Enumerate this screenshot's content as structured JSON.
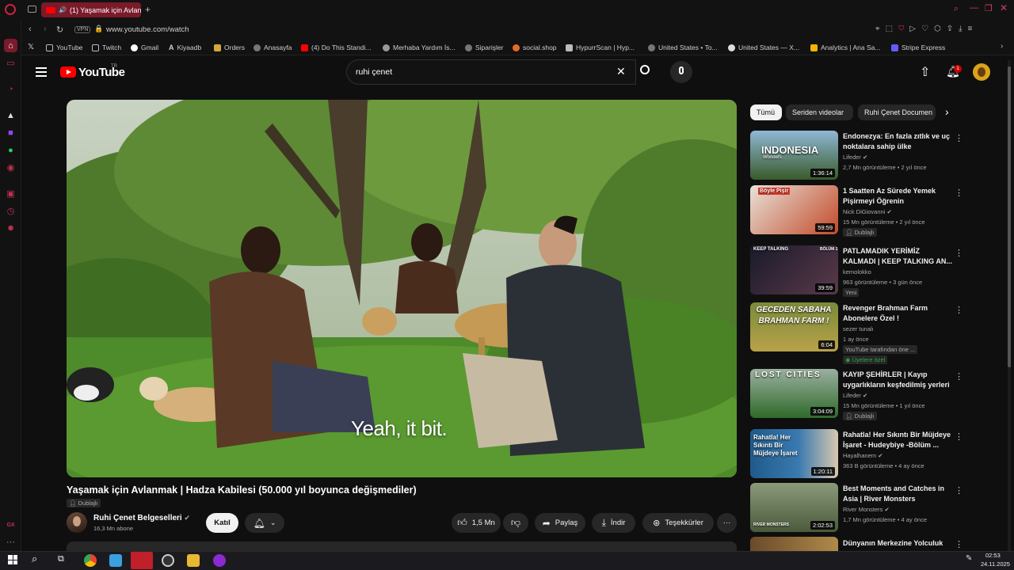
{
  "browser": {
    "tab_title": "(1) Yaşamak için Avlan",
    "url": "www.youtube.com/watch",
    "vpn_label": "VPN",
    "bookmarks": [
      {
        "label": "YouTube",
        "icon": "document-icon"
      },
      {
        "label": "Twitch",
        "icon": "document-icon"
      },
      {
        "label": "Gmail",
        "icon": "google-icon"
      },
      {
        "label": "Kiyaadb",
        "icon": "a-icon"
      },
      {
        "label": "Orders",
        "icon": "folder-icon"
      },
      {
        "label": "Anasayfa",
        "icon": "person-icon"
      },
      {
        "label": "(4) Do This Standi...",
        "icon": "youtube-icon"
      },
      {
        "label": "Merhaba Yardım İs...",
        "icon": "gear-icon"
      },
      {
        "label": "Siparişler",
        "icon": "person-icon"
      },
      {
        "label": "social.shop",
        "icon": "shop-icon"
      },
      {
        "label": "HypurrScan | Hyp...",
        "icon": "cat-icon"
      },
      {
        "label": "United States • To...",
        "icon": "person-icon"
      },
      {
        "label": "United States — X...",
        "icon": "globe-icon"
      },
      {
        "label": "Analytics | Ana Sa...",
        "icon": "chart-icon"
      },
      {
        "label": "Stripe Express",
        "icon": "stripe-icon"
      }
    ]
  },
  "youtube": {
    "logo_text": "YouTube",
    "logo_sup": "TR",
    "search_query": "ruhi çenet",
    "notification_count": "1"
  },
  "video": {
    "caption": "Yeah, it bit.",
    "title": "Yaşamak için Avlanmak | Hadza Kabilesi (50.000 yıl boyunca değişmediler)",
    "dub_label": "Dublajlı",
    "channel": "Ruhi Çenet Belgeselleri",
    "subscribers": "16,3 Mn abone",
    "join_label": "Katıl",
    "likes": "1,5 Mn",
    "share_label": "Paylaş",
    "download_label": "İndir",
    "thanks_label": "Teşekkürler"
  },
  "chips": [
    "Tümü",
    "Seriden videolar",
    "Ruhi Çenet Documen"
  ],
  "recommendations": [
    {
      "title": "Endonezya: En fazla zıtlık ve uç noktalara sahip ülke",
      "channel": "Lifeder",
      "verified": true,
      "meta": "2,7 Mn görüntüleme • 2 yıl önce",
      "duration": "1:36:14",
      "tag": "",
      "thumb_text": "INDONESIA",
      "thumb_sub": "Wonders"
    },
    {
      "title": "1 Saatten Az Sürede Yemek Pişirmeyi Öğrenin",
      "channel": "Nick DiGiovanni",
      "verified": true,
      "meta": "15 Mn görüntüleme • 2 yıl önce",
      "duration": "59:59",
      "tag": "Dublajlı",
      "thumb_text": "Böyle Pişir",
      "thumb_sub": ""
    },
    {
      "title": "PATLAMADIK YERİMİZ KALMADI | KEEP TALKING AN...",
      "channel": "kemolokko",
      "verified": false,
      "meta": "963 görüntüleme • 3 gün önce",
      "duration": "39:59",
      "tag": "Yeni",
      "thumb_text": "KEEP TALKING",
      "thumb_sub": "BÖLÜM 2"
    },
    {
      "title": "Revenger Brahman Farm Abonelere Özel !",
      "channel": "sezer tunalı",
      "verified": false,
      "meta": "1 ay önce",
      "duration": "6:04",
      "tag": "YouTube tarafından öne ...",
      "members": "Üyelere özel",
      "thumb_text": "GECEDEN SABAHA BRAHMAN FARM !",
      "thumb_sub": ""
    },
    {
      "title": "KAYIP ŞEHİRLER | Kayıp uygarlıkların keşfedilmiş yerleri",
      "channel": "Lifeder",
      "verified": true,
      "meta": "15 Mn görüntüleme • 1 yıl önce",
      "duration": "3:04:09",
      "tag": "Dublajlı",
      "thumb_text": "LOST CITIES",
      "thumb_sub": ""
    },
    {
      "title": "Rahatla! Her Sıkıntı Bir Müjdeye İşaret - Hudeybiye -Bölüm ...",
      "channel": "Hayalhanem",
      "verified": true,
      "meta": "363 B görüntüleme • 4 ay önce",
      "duration": "1:20:11",
      "tag": "",
      "thumb_text": "Rahatla! Her Sıkıntı Bir Müjdeye İşaret",
      "thumb_sub": ""
    },
    {
      "title": "Best Moments and Catches in Asia | River Monsters",
      "channel": "River Monsters",
      "verified": true,
      "meta": "1,7 Mn görüntüleme • 4 ay önce",
      "duration": "2:02:53",
      "tag": "",
      "thumb_text": "RIVER MONSTERS",
      "thumb_sub": ""
    },
    {
      "title": "Dünyanın Merkezine Yolculuk",
      "channel": "",
      "verified": false,
      "meta": "",
      "duration": "",
      "tag": "",
      "thumb_text": "",
      "thumb_sub": ""
    }
  ],
  "taskbar": {
    "time": "02:53",
    "date": "24.11.2025"
  },
  "colors": {
    "accent": "#ff0000",
    "background": "#0f0f0f",
    "opera_red": "#7a1a2a"
  }
}
